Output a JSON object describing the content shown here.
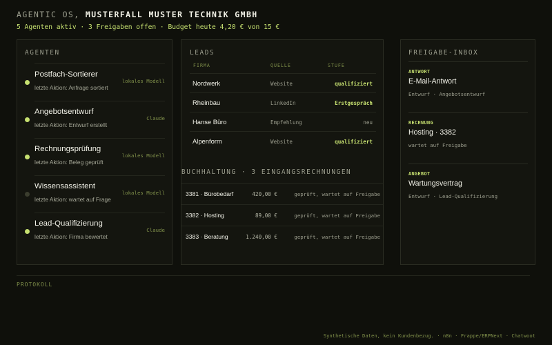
{
  "header": {
    "title_prefix": "AGENTIC OS,",
    "title_company": "MUSTERFALL MUSTER TECHNIK GMBH",
    "stats": "5 Agenten aktiv · 3 Freigaben offen · Budget heute 4,20 € von 15 €"
  },
  "agents": {
    "title": "AGENTEN",
    "items": [
      {
        "name": "Postfach-Sortierer",
        "action": "letzte Aktion: Anfrage sortiert",
        "model": "lokales Modell",
        "active": true
      },
      {
        "name": "Angebotsentwurf",
        "action": "letzte Aktion: Entwurf erstellt",
        "model": "Claude",
        "active": true
      },
      {
        "name": "Rechnungsprüfung",
        "action": "letzte Aktion: Beleg geprüft",
        "model": "lokales Modell",
        "active": true
      },
      {
        "name": "Wissensassistent",
        "action": "letzte Aktion: wartet auf Frage",
        "model": "lokales Modell",
        "active": false
      },
      {
        "name": "Lead-Qualifizierung",
        "action": "letzte Aktion: Firma bewertet",
        "model": "Claude",
        "active": true
      }
    ]
  },
  "leads": {
    "title": "LEADS",
    "columns": [
      "FIRMA",
      "QUELLE",
      "STUFE"
    ],
    "rows": [
      {
        "firma": "Nordwerk",
        "quelle": "Website",
        "stufe": "qualifiziert",
        "highlight": true
      },
      {
        "firma": "Rheinbau",
        "quelle": "LinkedIn",
        "stufe": "Erstgespräch",
        "highlight": true
      },
      {
        "firma": "Hanse Büro",
        "quelle": "Empfehlung",
        "stufe": "neu",
        "highlight": false
      },
      {
        "firma": "Alpenform",
        "quelle": "Website",
        "stufe": "qualifiziert",
        "highlight": true
      }
    ]
  },
  "buchhaltung": {
    "title": "BUCHHALTUNG · 3 EINGANGSRECHNUNGEN",
    "rows": [
      {
        "name": "3381 · Bürobedarf",
        "amount": "420,00 €",
        "status": "geprüft, wartet auf Freigabe"
      },
      {
        "name": "3382 · Hosting",
        "amount": "89,00 €",
        "status": "geprüft, wartet auf Freigabe"
      },
      {
        "name": "3383 · Beratung",
        "amount": "1.240,00 €",
        "status": "geprüft, wartet auf Freigabe"
      }
    ]
  },
  "inbox": {
    "title": "FREIGABE-INBOX",
    "cards": [
      {
        "tag": "ANTWORT",
        "title": "E-Mail-Antwort",
        "sub": "Entwurf · Angebotsentwurf"
      },
      {
        "tag": "RECHNUNG",
        "title": "Hosting · 3382",
        "sub": "wartet auf Freigabe"
      },
      {
        "tag": "ANGEBOT",
        "title": "Wartungsvertrag",
        "sub": "Entwurf · Lead-Qualifizierung"
      }
    ]
  },
  "protokoll": {
    "title": "PROTOKOLL"
  },
  "footer": {
    "text": "Synthetische Daten, kein Kundenbezug. · n8n · Frappe/ERPNext · Chatwoot"
  },
  "colors": {
    "accent": "#c6e070",
    "background": "#0f100b",
    "panel": "#14150f",
    "dim_dot": "#3b3d2e"
  }
}
